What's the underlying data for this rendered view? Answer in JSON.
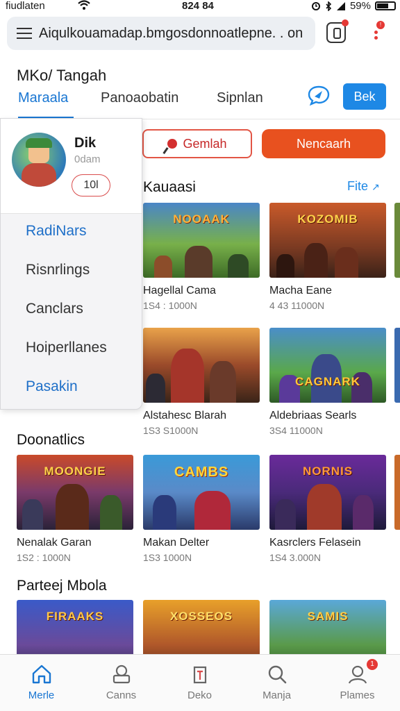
{
  "status_bar": {
    "carrier": "fiudlaten",
    "time": "824 84",
    "battery": "59%"
  },
  "browser": {
    "url": "Aiqulkouamadap.bmgosdonnoatlepne. . on",
    "tabs_badge": "!"
  },
  "header": {
    "title": "MKo/ Tangah",
    "tabs": [
      {
        "label": "Maraala",
        "active": true
      },
      {
        "label": "Panoaobatin",
        "active": false
      },
      {
        "label": "Sipnlan",
        "active": false
      }
    ],
    "button_label": "Bek"
  },
  "drawer": {
    "profile": {
      "name": "Dik",
      "subtitle": "0dam",
      "badge": "10l"
    },
    "items": [
      {
        "label": "RadiNars",
        "accent": true
      },
      {
        "label": "Risnrlings",
        "accent": false
      },
      {
        "label": "Canclars",
        "accent": false
      },
      {
        "label": "Hoiperllanes",
        "accent": false
      },
      {
        "label": "Pasakin",
        "accent": true
      }
    ]
  },
  "actions": {
    "outline_label": "Gemlah",
    "solid_label": "Nencaarh"
  },
  "sections": {
    "first": {
      "title": "Kauaasi",
      "link": "Fite",
      "cards": [
        {
          "name": "Hagellal Cama",
          "meta": "1S4 : 1000N",
          "logo": "NOOAAK"
        },
        {
          "name": "Macha Eane",
          "meta": "4 43 11000N",
          "logo": "KOZOMIB"
        },
        {
          "name": "Alstahesc Blarah",
          "meta": "1S3 S1000N",
          "logo": ""
        },
        {
          "name": "Aldebriaas Searls",
          "meta": "3S4 11000N",
          "logo": "CAGNARK"
        }
      ]
    },
    "second": {
      "title": "Doonatlics",
      "cards": [
        {
          "name": "Nenalak Garan",
          "meta": "1S2 : 1000N",
          "logo": "MOONGIE"
        },
        {
          "name": "Makan Delter",
          "meta": "1S3 1000N",
          "logo": "CAMBS"
        },
        {
          "name": "Kasrclers Felasein",
          "meta": "1S4 3.000N",
          "logo": "NORNIS"
        }
      ]
    },
    "third": {
      "title": "Parteej Mbola",
      "logos": [
        "FIRAAKS",
        "XOSSEOS",
        "SAMIS"
      ]
    }
  },
  "bottom_nav": {
    "items": [
      {
        "label": "Merle",
        "icon": "home-icon",
        "active": true
      },
      {
        "label": "Canns",
        "icon": "games-icon",
        "active": false
      },
      {
        "label": "Deko",
        "icon": "tag-icon",
        "active": false
      },
      {
        "label": "Manja",
        "icon": "search-icon",
        "active": false
      },
      {
        "label": "Plames",
        "icon": "profile-icon",
        "active": false,
        "badge": "1"
      }
    ]
  },
  "colors": {
    "accent_blue": "#1976d2",
    "accent_orange": "#e8511f",
    "badge_red": "#e53935"
  }
}
